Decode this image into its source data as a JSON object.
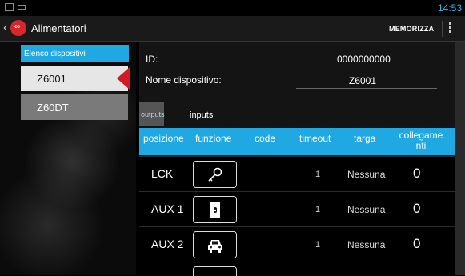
{
  "status_bar": {
    "time": "14:53",
    "icons": [
      "image-icon",
      "notification-icon"
    ]
  },
  "action_bar": {
    "back_icon": "chevron-left-icon",
    "title": "Alimentatori",
    "action": "MEMORIZZA",
    "overflow_icon": "overflow-menu-icon",
    "logo_color": "#d9262c"
  },
  "device_list": {
    "header": "Elenco dispositivi",
    "items": [
      {
        "label": "Z6001",
        "selected": true
      },
      {
        "label": "Z60DT",
        "selected": false
      }
    ]
  },
  "detail": {
    "id_label": "ID:",
    "id_value": "0000000000",
    "name_label": "Nome dispositivo:",
    "name_value": "Z6001",
    "tabs": [
      {
        "label": "outputs",
        "active": true
      },
      {
        "label": "inputs",
        "active": false
      }
    ],
    "columns": [
      "posizione",
      "funzione",
      "code",
      "timeout",
      "targa",
      "collegame nti"
    ],
    "rows": [
      {
        "posizione": "LCK",
        "funzione_icon": "key-icon",
        "code": "",
        "timeout": "1",
        "targa": "Nessuna",
        "collegamenti": "0"
      },
      {
        "posizione": "AUX 1",
        "funzione_icon": "door-icon",
        "code": "",
        "timeout": "1",
        "targa": "Nessuna",
        "collegamenti": "0"
      },
      {
        "posizione": "AUX 2",
        "funzione_icon": "car-icon",
        "code": "",
        "timeout": "1",
        "targa": "Nessuna",
        "collegamenti": "0"
      }
    ]
  },
  "colors": {
    "accent": "#1fa8e2",
    "selection_arrow": "#d01c22",
    "status_clock": "#33b5e5"
  }
}
